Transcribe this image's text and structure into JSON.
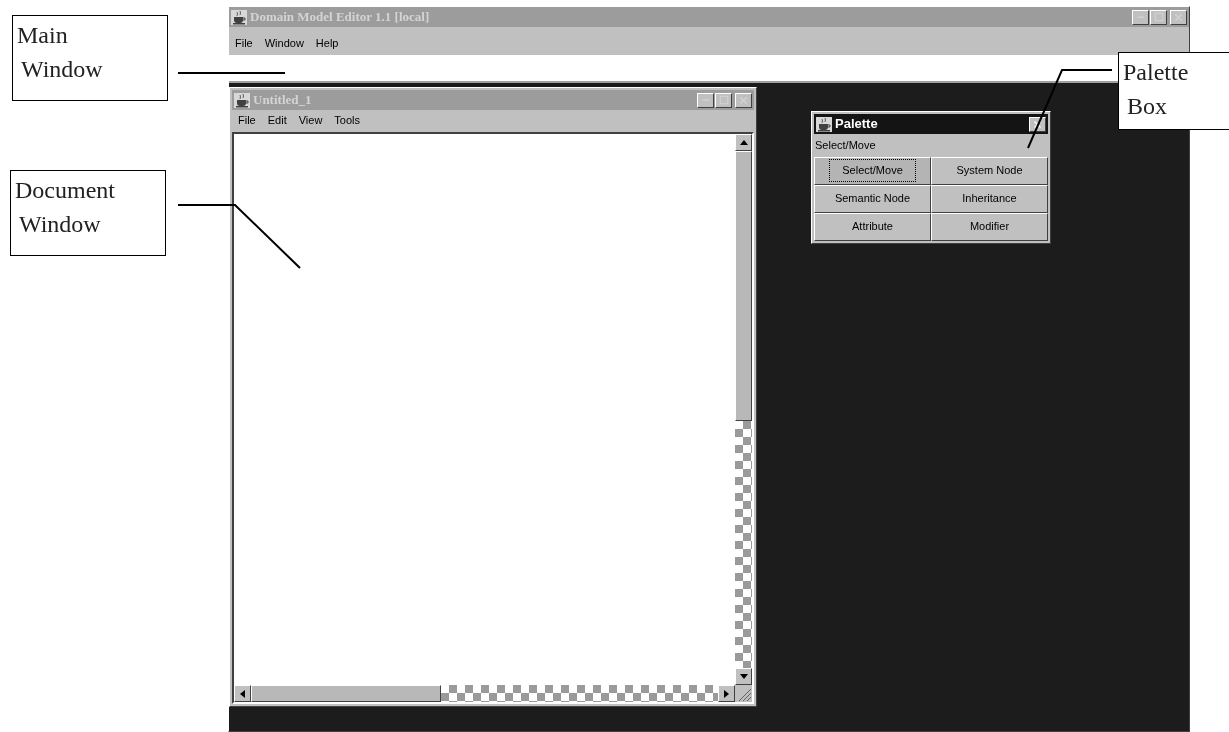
{
  "callouts": [
    {
      "lines": [
        "Main",
        "Window"
      ]
    },
    {
      "lines": [
        "Document",
        "Window"
      ]
    },
    {
      "lines": [
        "Palette",
        "Box"
      ]
    }
  ],
  "main_window": {
    "title": "Domain Model Editor 1.1 [local]",
    "active": false,
    "menu": [
      "File",
      "Window",
      "Help"
    ]
  },
  "document_window": {
    "title": "Untitled_1",
    "active": false,
    "menu": [
      "File",
      "Edit",
      "View",
      "Tools"
    ]
  },
  "palette": {
    "title": "Palette",
    "active": true,
    "status": "Select/Move",
    "tools": [
      {
        "label": "Select/Move",
        "selected": true
      },
      {
        "label": "System Node",
        "selected": false
      },
      {
        "label": "Semantic Node",
        "selected": false
      },
      {
        "label": "Inheritance",
        "selected": false
      },
      {
        "label": "Attribute",
        "selected": false
      },
      {
        "label": "Modifier",
        "selected": false
      }
    ]
  }
}
